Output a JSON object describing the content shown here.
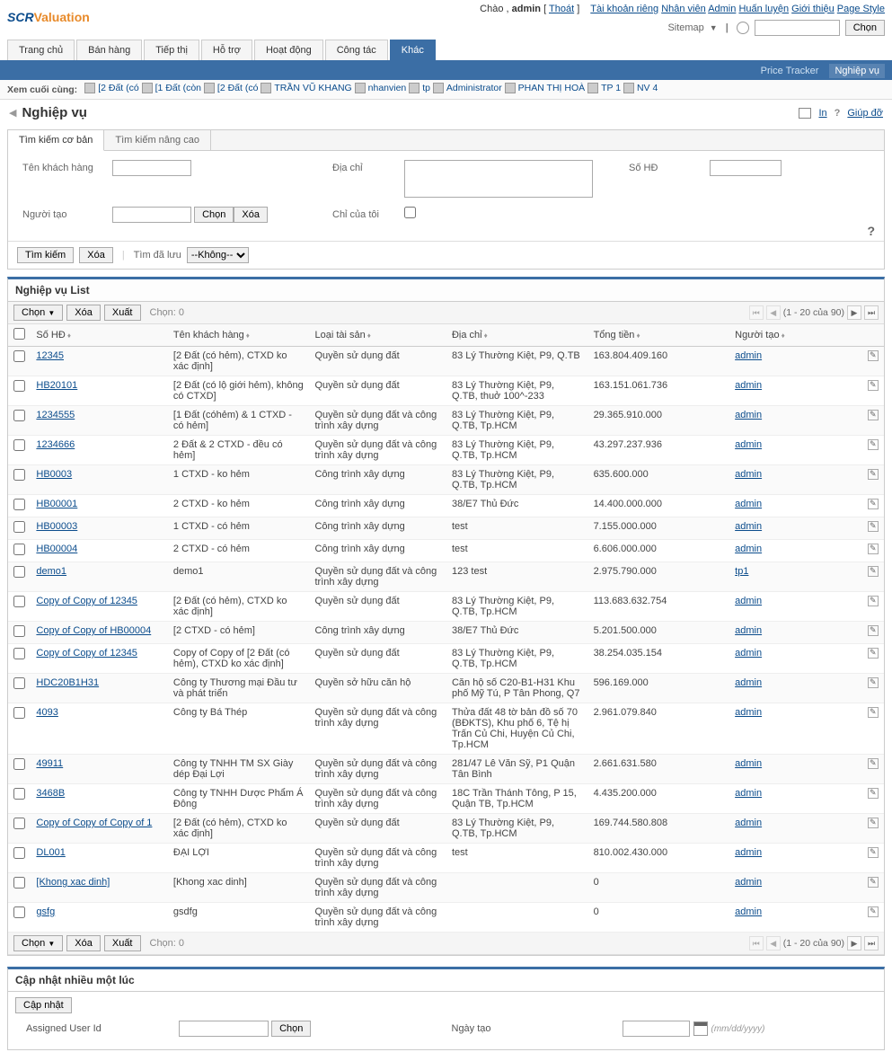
{
  "logo": {
    "part1": "SCR",
    "part2": "Valuation"
  },
  "top_right": {
    "greeting": "Chào , ",
    "user": "admin",
    "logout_open": " [ ",
    "logout": "Thoát",
    "logout_close": " ]",
    "links": [
      "Tài khoản riêng",
      "Nhân viên",
      "Admin",
      "Huấn luyện",
      "Giới thiệu",
      "Page Style"
    ],
    "sitemap": "Sitemap",
    "search_button": "Chọn"
  },
  "main_tabs": [
    "Trang chủ",
    "Bán hàng",
    "Tiếp thị",
    "Hỗ trợ",
    "Hoạt động",
    "Công tác",
    "Khác"
  ],
  "main_tabs_active": 6,
  "sub_tabs": {
    "items": [
      "Price Tracker",
      "Nghiệp vụ"
    ],
    "active": 1
  },
  "recent": {
    "label": "Xem cuối cùng:",
    "items": [
      "[2 Đất (có",
      "[1 Đất (còn",
      "[2 Đất (có",
      "TRẦN VŨ KHANG",
      "nhanvien",
      "tp",
      "Administrator",
      "PHAN THỊ HOÀ",
      "TP 1",
      "NV 4"
    ]
  },
  "page": {
    "title": "Nghiệp vụ",
    "print": "In",
    "help_q": "?",
    "help": "Giúp đỡ"
  },
  "search": {
    "tabs": [
      "Tìm kiếm cơ bản",
      "Tìm kiếm nâng cao"
    ],
    "tabs_active": 0,
    "fields": {
      "customer": "Tên khách hàng",
      "address": "Địa chỉ",
      "contract": "Số HĐ",
      "creator": "Người tạo",
      "creator_choose": "Chọn",
      "creator_clear": "Xóa",
      "only_mine": "Chỉ của tôi"
    },
    "actions": {
      "search": "Tìm kiếm",
      "clear": "Xóa",
      "saved_label": "Tìm đã lưu",
      "saved_none": "--Không--",
      "help": "?"
    }
  },
  "list": {
    "title": "Nghiệp vụ List",
    "toolbar": {
      "choose": "Chọn",
      "delete": "Xóa",
      "export": "Xuất",
      "selected_label": "Chọn:",
      "selected_count": "0"
    },
    "pagination": {
      "range": "(1 - 20 của 90)"
    },
    "columns": [
      "Số HĐ",
      "Tên khách hàng",
      "Loại tài sản",
      "Địa chỉ",
      "Tổng tiền",
      "Người tạo"
    ],
    "rows": [
      {
        "hd": "12345",
        "name": "[2 Đất (có hẻm), CTXD ko xác định]",
        "asset": "Quyền sử dụng đất",
        "addr": "83 Lý Thường Kiệt, P9, Q.TB",
        "money": "163.804.409.160",
        "creator": "admin"
      },
      {
        "hd": "HB20101",
        "name": "[2 Đất (có lộ giới hẻm), không có CTXD]",
        "asset": "Quyền sử dụng đất",
        "addr": "83 Lý Thường Kiệt, P9, Q.TB, thuở 100^-233",
        "money": "163.151.061.736",
        "creator": "admin"
      },
      {
        "hd": "1234555",
        "name": "[1 Đất (cóhẻm) & 1 CTXD - có hẻm]",
        "asset": "Quyền sử dụng đất và công trình xây dựng",
        "addr": "83 Lý Thường Kiệt, P9, Q.TB, Tp.HCM",
        "money": "29.365.910.000",
        "creator": "admin"
      },
      {
        "hd": "1234666",
        "name": "2 Đất & 2 CTXD - đều có hẻm]",
        "asset": "Quyền sử dụng đất và công trình xây dựng",
        "addr": "83 Lý Thường Kiệt, P9, Q.TB, Tp.HCM",
        "money": "43.297.237.936",
        "creator": "admin"
      },
      {
        "hd": "HB0003",
        "name": "1 CTXD - ko hẻm",
        "asset": "Công trình xây dựng",
        "addr": "83 Lý Thường Kiệt, P9, Q.TB, Tp.HCM",
        "money": "635.600.000",
        "creator": "admin"
      },
      {
        "hd": "HB00001",
        "name": "2 CTXD - ko hẻm",
        "asset": "Công trình xây dựng",
        "addr": "38/E7 Thủ Đức",
        "money": "14.400.000.000",
        "creator": "admin"
      },
      {
        "hd": "HB00003",
        "name": "1 CTXD - có hẻm",
        "asset": "Công trình xây dựng",
        "addr": "test",
        "money": "7.155.000.000",
        "creator": "admin"
      },
      {
        "hd": "HB00004",
        "name": "2 CTXD - có hẻm",
        "asset": "Công trình xây dựng",
        "addr": "test",
        "money": "6.606.000.000",
        "creator": "admin"
      },
      {
        "hd": "demo1",
        "name": "demo1",
        "asset": "Quyền sử dụng đất và công trình xây dựng",
        "addr": "123 test",
        "money": "2.975.790.000",
        "creator": "tp1"
      },
      {
        "hd": "Copy of Copy of 12345",
        "name": "[2 Đất (có hẻm), CTXD ko xác định]",
        "asset": "Quyền sử dụng đất",
        "addr": "83 Lý Thường Kiệt, P9, Q.TB, Tp.HCM",
        "money": "113.683.632.754",
        "creator": "admin"
      },
      {
        "hd": "Copy of Copy of HB00004",
        "name": "[2 CTXD - có hẻm]",
        "asset": "Công trình xây dựng",
        "addr": "38/E7 Thủ Đức",
        "money": "5.201.500.000",
        "creator": "admin"
      },
      {
        "hd": "Copy of Copy of 12345",
        "name": "Copy of Copy of [2 Đất (có hẻm), CTXD ko xác định]",
        "asset": "Quyền sử dụng đất",
        "addr": "83 Lý Thường Kiệt, P9, Q.TB, Tp.HCM",
        "money": "38.254.035.154",
        "creator": "admin"
      },
      {
        "hd": "HDC20B1H31",
        "name": "Công ty Thương mại Đầu tư và phát triển",
        "asset": "Quyền sở hữu căn hộ",
        "addr": "Căn hộ số C20-B1-H31 Khu phố Mỹ Tú, P Tân Phong, Q7",
        "money": "596.169.000",
        "creator": "admin"
      },
      {
        "hd": "4093",
        "name": "Công ty Bá Thép",
        "asset": "Quyền sử dụng đất và công trình xây dựng",
        "addr": "Thửa đất 48 tờ bản đồ số 70 (BĐKTS), Khu phố 6, Tệ hị Trấn Củ Chi, Huyện Củ Chi, Tp.HCM",
        "money": "2.961.079.840",
        "creator": "admin"
      },
      {
        "hd": "49911",
        "name": "Công ty TNHH TM SX Giày dép Đại Lợi",
        "asset": "Quyền sử dụng đất và công trình xây dựng",
        "addr": "281/47 Lê Văn Sỹ, P1 Quận Tân Bình",
        "money": "2.661.631.580",
        "creator": "admin"
      },
      {
        "hd": "3468B",
        "name": "Công ty TNHH Dược Phẩm Á Đông",
        "asset": "Quyền sử dụng đất và công trình xây dựng",
        "addr": "18C Trần Thánh Tông, P 15, Quận TB, Tp.HCM",
        "money": "4.435.200.000",
        "creator": "admin"
      },
      {
        "hd": "Copy of Copy of Copy of 1",
        "name": "[2 Đất (có hẻm), CTXD ko xác định]",
        "asset": "Quyền sử dụng đất",
        "addr": "83 Lý Thường Kiệt, P9, Q.TB, Tp.HCM",
        "money": "169.744.580.808",
        "creator": "admin"
      },
      {
        "hd": "DL001",
        "name": "ĐẠI LỢI",
        "asset": "Quyền sử dụng đất và công trình xây dựng",
        "addr": "test",
        "money": "810.002.430.000",
        "creator": "admin"
      },
      {
        "hd": "[Khong xac dinh]",
        "name": "[Khong xac dinh]",
        "asset": "Quyền sử dụng đất và công trình xây dựng",
        "addr": "",
        "money": "0",
        "creator": "admin"
      },
      {
        "hd": "gsfg",
        "name": "gsdfg",
        "asset": "Quyền sử dụng đất và công trình xây dựng",
        "addr": "",
        "money": "0",
        "creator": "admin"
      }
    ]
  },
  "update": {
    "title": "Cập nhật nhiều một lúc",
    "button": "Cập nhật",
    "assigned": "Assigned User Id",
    "assigned_choose": "Chọn",
    "created": "Ngày tạo",
    "date_hint": "(mm/dd/yyyy)"
  }
}
